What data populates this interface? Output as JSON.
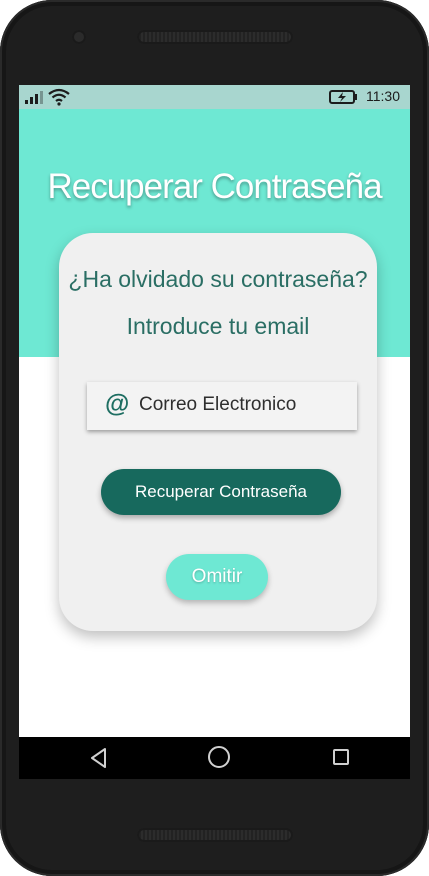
{
  "status_bar": {
    "time": "11:30",
    "icons": [
      "signal-icon",
      "wifi-icon",
      "battery-charging-icon"
    ]
  },
  "header": {
    "title": "Recuperar Contraseña"
  },
  "card": {
    "question": "¿Ha olvidado su contraseña?",
    "instruction": "Introduce tu email",
    "email_field": {
      "icon": "at-icon",
      "icon_glyph": "@",
      "value": "",
      "placeholder": "Correo Electronico"
    },
    "recover_button": "Recuperar Contraseña",
    "skip_button": "Omitir"
  },
  "nav_bar": {
    "icons": [
      "back-icon",
      "home-icon",
      "recents-icon"
    ]
  },
  "colors": {
    "accent": "#6ee8d3",
    "primary_dark": "#17695d",
    "text_teal": "#2a6e64",
    "card_bg": "#f0f0f0"
  }
}
